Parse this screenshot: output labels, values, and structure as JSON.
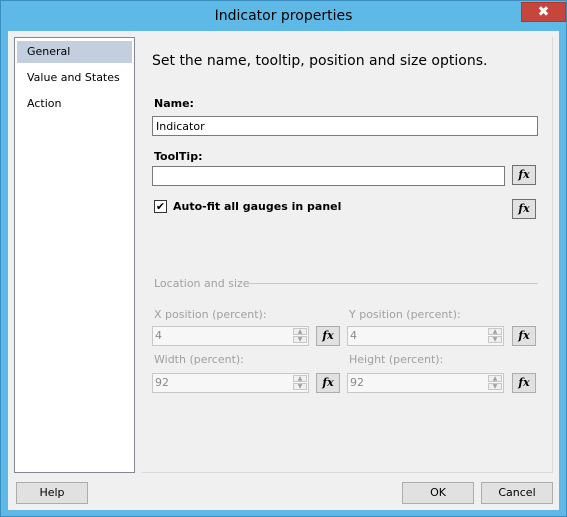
{
  "window": {
    "title": "Indicator properties",
    "close_glyph": "✖"
  },
  "nav": {
    "items": [
      {
        "label": "General",
        "selected": true
      },
      {
        "label": "Value and States",
        "selected": false
      },
      {
        "label": "Action",
        "selected": false
      }
    ]
  },
  "content": {
    "heading": "Set the name, tooltip, position and size options.",
    "name_label": "Name:",
    "name_value": "Indicator",
    "tooltip_label": "ToolTip:",
    "tooltip_value": "",
    "fx_label": "fx",
    "autofit_label": "Auto-fit all gauges in panel",
    "autofit_checked": true,
    "location_group": "Location and size",
    "x_label": "X position (percent):",
    "x_value": "4",
    "y_label": "Y position (percent):",
    "y_value": "4",
    "width_label": "Width (percent):",
    "width_value": "92",
    "height_label": "Height (percent):",
    "height_value": "92"
  },
  "footer": {
    "help": "Help",
    "ok": "OK",
    "cancel": "Cancel"
  },
  "colors": {
    "title_bar": "#5fb9e6",
    "close_button": "#c7463c",
    "nav_selected": "#c3cede"
  }
}
